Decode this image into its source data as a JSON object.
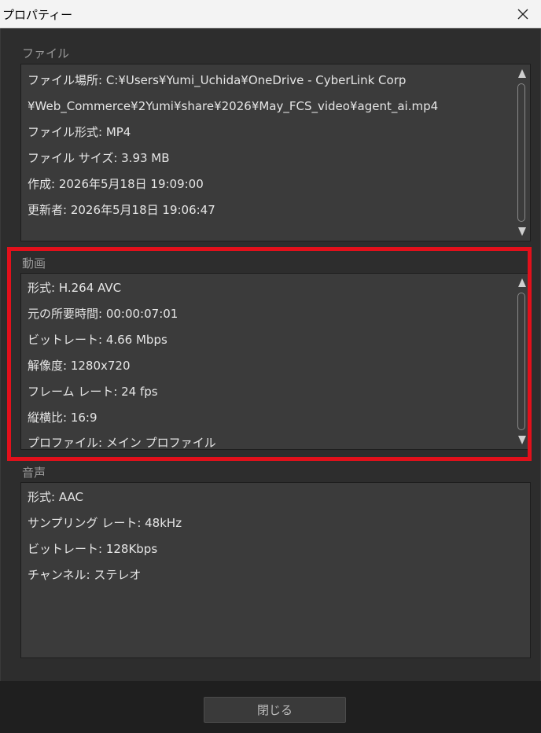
{
  "window": {
    "title": "プロパティー"
  },
  "file_section": {
    "label": "ファイル",
    "rows": [
      "ファイル場所: C:¥Users¥Yumi_Uchida¥OneDrive - CyberLink Corp",
      "¥Web_Commerce¥2Yumi¥share¥2026¥May_FCS_video¥agent_ai.mp4",
      "ファイル形式: MP4",
      "ファイル サイズ: 3.93 MB",
      "作成: 2026年5月18日 19:09:00",
      "更新者: 2026年5月18日 19:06:47"
    ]
  },
  "video_section": {
    "label": "動画",
    "rows": [
      "形式: H.264 AVC",
      "元の所要時間: 00:00:07:01",
      "ビットレート: 4.66 Mbps",
      "解像度: 1280x720",
      "フレーム レート: 24 fps",
      "縦横比: 16:9",
      "プロファイル: メイン プロファイル"
    ]
  },
  "audio_section": {
    "label": "音声",
    "rows": [
      "形式: AAC",
      "サンプリング レート: 48kHz",
      "ビットレート: 128Kbps",
      "チャンネル: ステレオ"
    ]
  },
  "footer": {
    "close_label": "閉じる"
  },
  "colors": {
    "highlight": "#e2101b"
  }
}
